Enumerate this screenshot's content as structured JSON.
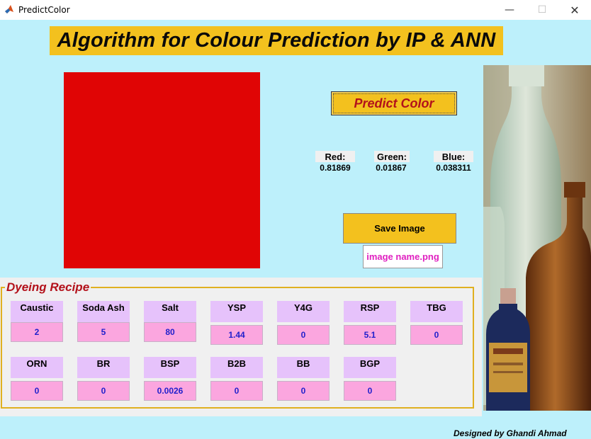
{
  "window": {
    "title": "PredictColor",
    "minimize_glyph": "—",
    "maximize_glyph": "☐",
    "close_glyph": "✕",
    "app_icon": "matlab-icon"
  },
  "heading": "Algorithm for Colour Prediction by IP & ANN",
  "colors": {
    "swatch": "#e00505",
    "accent": "#f3c11e",
    "predict_text": "#b3121b",
    "recipe_label_bg": "#e6c2fb",
    "recipe_value_bg": "#fba6df",
    "recipe_value_text": "#1f1fcc",
    "background": "#bdf0fb"
  },
  "predict_button": "Predict Color",
  "rgb": {
    "red": {
      "label": "Red:",
      "value": "0.81869"
    },
    "green": {
      "label": "Green:",
      "value": "0.01867"
    },
    "blue": {
      "label": "Blue:",
      "value": "0.038311"
    }
  },
  "save_button": "Save Image",
  "image_name": {
    "value": "image name.png"
  },
  "recipe": {
    "title": "Dyeing Recipe",
    "row1": [
      {
        "label": "Caustic",
        "value": "2"
      },
      {
        "label": "Soda Ash",
        "value": "5"
      },
      {
        "label": "Salt",
        "value": "80"
      },
      {
        "label": "YSP",
        "value": "1.44"
      },
      {
        "label": "Y4G",
        "value": "0"
      },
      {
        "label": "RSP",
        "value": "5.1"
      },
      {
        "label": "TBG",
        "value": "0"
      }
    ],
    "row2": [
      {
        "label": "ORN",
        "value": "0"
      },
      {
        "label": "BR",
        "value": "0"
      },
      {
        "label": "BSP",
        "value": "0.0026"
      },
      {
        "label": "B2B",
        "value": "0"
      },
      {
        "label": "BB",
        "value": "0"
      },
      {
        "label": "BGP",
        "value": "0"
      }
    ]
  },
  "credit": "Designed by Ghandi Ahmad"
}
